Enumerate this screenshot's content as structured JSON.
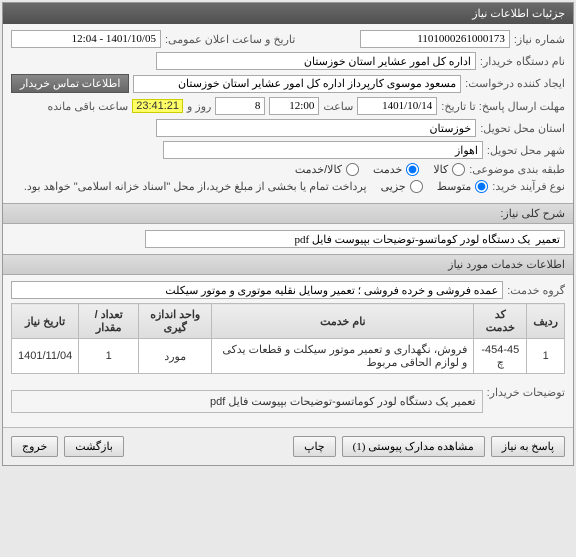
{
  "panel": {
    "title": "جزئیات اطلاعات نیاز"
  },
  "form": {
    "need_number_label": "شماره نیاز:",
    "need_number_value": "1101000261000173",
    "public_announce_label": "تاریخ و ساعت اعلان عمومی:",
    "public_announce_value": "1401/10/05 - 12:04",
    "buyer_label": "نام دستگاه خریدار:",
    "buyer_value": "اداره کل امور عشایر استان خوزستان",
    "creator_label": "ایجاد کننده درخواست:",
    "creator_value": "مسعود موسوی کارپرداز اداره کل امور عشایر استان خوزستان",
    "contact_button": "اطلاعات تماس خریدار",
    "deadline_label": "مهلت ارسال پاسخ: تا تاریخ:",
    "deadline_date": "1401/10/14",
    "deadline_hour_label": "ساعت",
    "deadline_hour": "12:00",
    "days_label": "روز و",
    "days_value": "8",
    "remaining_hours": "23:41:21",
    "remaining_label": "ساعت باقی مانده",
    "province_label": "استان محل تحویل:",
    "province_value": "خوزستان",
    "city_label": "شهر محل تحویل:",
    "city_value": "اهواز",
    "class_label": "طبقه بندی موضوعی:",
    "class_goods": "کالا",
    "class_service": "خدمت",
    "class_both": "کالا/خدمت",
    "purchase_type_label": "نوع فرآیند خرید:",
    "purchase_medium": "متوسط",
    "purchase_minor": "جزیی",
    "payment_note": "پرداخت تمام یا بخشی از مبلغ خرید،از محل \"اسناد خزانه اسلامی\" خواهد بود."
  },
  "desc": {
    "title_label": "شرح کلی نیاز:",
    "title_value": "تعمیر  یک دستگاه لودر کوماتسو-توضیحات بپیوست فایل pdf",
    "services_header": "اطلاعات خدمات مورد نیاز",
    "group_label": "گروه خدمت:",
    "group_value": "عمده فروشی و خرده فروشی ؛ تعمیر وسایل نقلیه موتوری و موتور سیکلت"
  },
  "table": {
    "headers": [
      "ردیف",
      "کد خدمت",
      "نام خدمت",
      "واحد اندازه گیری",
      "تعداد / مقدار",
      "تاریخ نیاز"
    ],
    "rows": [
      {
        "idx": "1",
        "code": "454-45-چ",
        "name": "فروش، نگهداری و تعمیر موتور سیکلت و قطعات یدکی و لوازم الحاقی مربوط",
        "unit": "مورد",
        "qty": "1",
        "date": "1401/11/04"
      }
    ]
  },
  "buyer_note": {
    "label": "توضیحات خریدار:",
    "value": "تعمیر  یک دستگاه لودر کوماتسو-توضیحات بپیوست فایل pdf"
  },
  "buttons": {
    "reply": "پاسخ به نیاز",
    "attachments": "مشاهده مدارک پیوستی (1)",
    "print": "چاپ",
    "back": "بازگشت",
    "exit": "خروج"
  }
}
